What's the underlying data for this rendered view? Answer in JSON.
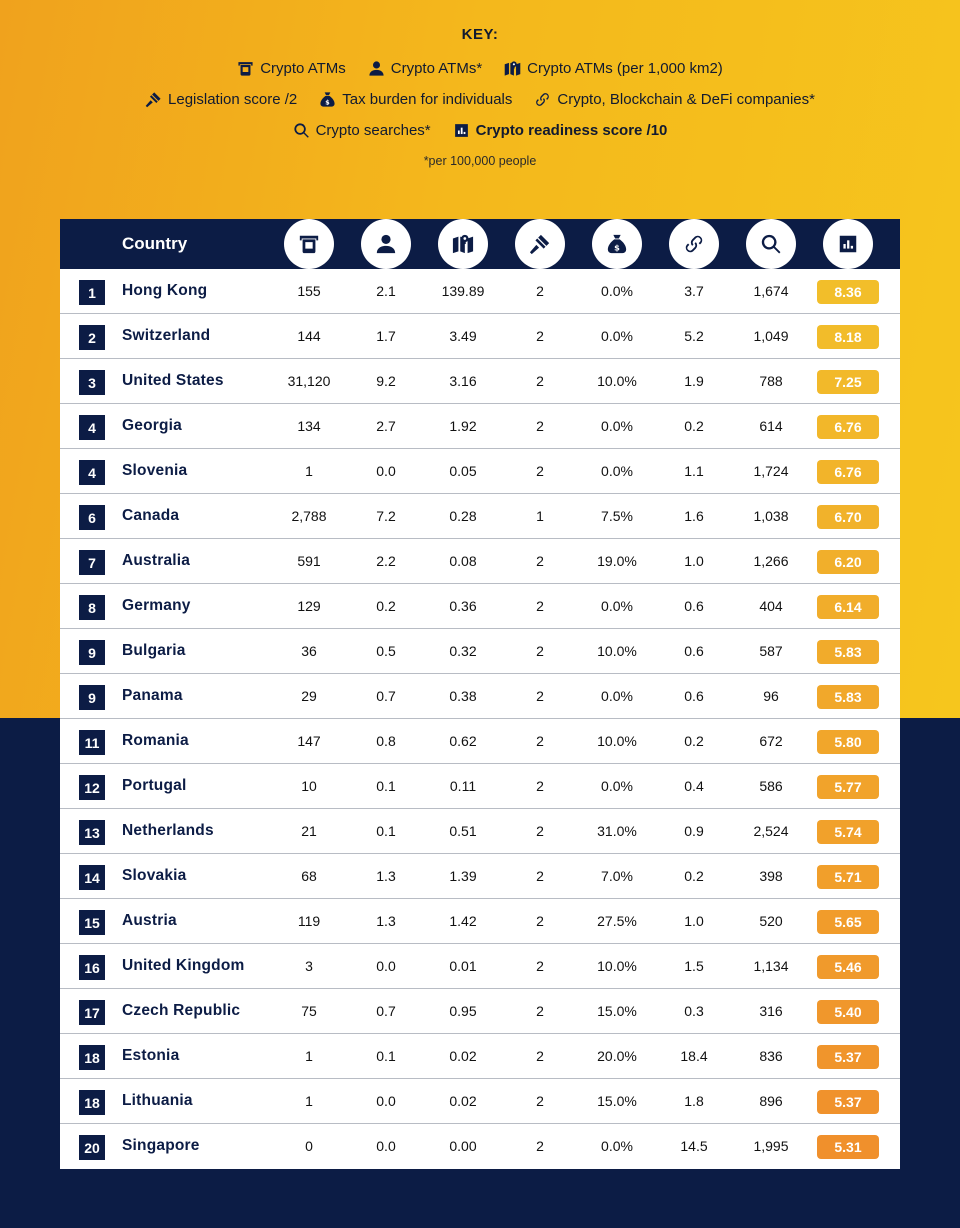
{
  "key": {
    "title": "KEY:",
    "rows": [
      [
        {
          "icon": "atm-icon",
          "label": "Crypto ATMs"
        },
        {
          "icon": "person-icon",
          "label": "Crypto ATMs*"
        },
        {
          "icon": "map-pin-icon",
          "label": "Crypto ATMs (per 1,000 km2)"
        }
      ],
      [
        {
          "icon": "gavel-icon",
          "label": "Legislation score /2"
        },
        {
          "icon": "money-bag-icon",
          "label": "Tax burden for individuals"
        },
        {
          "icon": "chain-link-icon",
          "label": "Crypto, Blockchain & DeFi companies*"
        }
      ],
      [
        {
          "icon": "search-icon",
          "label": "Crypto searches*"
        },
        {
          "icon": "bar-chart-icon",
          "label": "Crypto readiness score /10",
          "bold": true
        }
      ]
    ],
    "note": "*per 100,000 people"
  },
  "table": {
    "country_header": "Country",
    "column_icons": [
      "atm-icon",
      "person-icon",
      "map-pin-icon",
      "gavel-icon",
      "money-bag-icon",
      "chain-link-icon",
      "search-icon",
      "bar-chart-icon"
    ],
    "columns": [
      "Crypto ATMs",
      "Crypto ATMs per 100,000 people",
      "Crypto ATMs per 1,000 km2",
      "Legislation score /2",
      "Tax burden for individuals",
      "Crypto, Blockchain & DeFi companies per 100,000 people",
      "Crypto searches per 100,000 people",
      "Crypto readiness score /10"
    ],
    "rows": [
      {
        "rank": "1",
        "country": "Hong Kong",
        "atms": "155",
        "atms_per_capita": "2.1",
        "atms_per_area": "139.89",
        "legislation": "2",
        "tax": "0.0%",
        "companies": "3.7",
        "searches": "1,674",
        "score": "8.36"
      },
      {
        "rank": "2",
        "country": "Switzerland",
        "atms": "144",
        "atms_per_capita": "1.7",
        "atms_per_area": "3.49",
        "legislation": "2",
        "tax": "0.0%",
        "companies": "5.2",
        "searches": "1,049",
        "score": "8.18"
      },
      {
        "rank": "3",
        "country": "United States",
        "atms": "31,120",
        "atms_per_capita": "9.2",
        "atms_per_area": "3.16",
        "legislation": "2",
        "tax": "10.0%",
        "companies": "1.9",
        "searches": "788",
        "score": "7.25"
      },
      {
        "rank": "4",
        "country": "Georgia",
        "atms": "134",
        "atms_per_capita": "2.7",
        "atms_per_area": "1.92",
        "legislation": "2",
        "tax": "0.0%",
        "companies": "0.2",
        "searches": "614",
        "score": "6.76"
      },
      {
        "rank": "4",
        "country": "Slovenia",
        "atms": "1",
        "atms_per_capita": "0.0",
        "atms_per_area": "0.05",
        "legislation": "2",
        "tax": "0.0%",
        "companies": "1.1",
        "searches": "1,724",
        "score": "6.76"
      },
      {
        "rank": "6",
        "country": "Canada",
        "atms": "2,788",
        "atms_per_capita": "7.2",
        "atms_per_area": "0.28",
        "legislation": "1",
        "tax": "7.5%",
        "companies": "1.6",
        "searches": "1,038",
        "score": "6.70"
      },
      {
        "rank": "7",
        "country": "Australia",
        "atms": "591",
        "atms_per_capita": "2.2",
        "atms_per_area": "0.08",
        "legislation": "2",
        "tax": "19.0%",
        "companies": "1.0",
        "searches": "1,266",
        "score": "6.20"
      },
      {
        "rank": "8",
        "country": "Germany",
        "atms": "129",
        "atms_per_capita": "0.2",
        "atms_per_area": "0.36",
        "legislation": "2",
        "tax": "0.0%",
        "companies": "0.6",
        "searches": "404",
        "score": "6.14"
      },
      {
        "rank": "9",
        "country": "Bulgaria",
        "atms": "36",
        "atms_per_capita": "0.5",
        "atms_per_area": "0.32",
        "legislation": "2",
        "tax": "10.0%",
        "companies": "0.6",
        "searches": "587",
        "score": "5.83"
      },
      {
        "rank": "9",
        "country": "Panama",
        "atms": "29",
        "atms_per_capita": "0.7",
        "atms_per_area": "0.38",
        "legislation": "2",
        "tax": "0.0%",
        "companies": "0.6",
        "searches": "96",
        "score": "5.83"
      },
      {
        "rank": "11",
        "country": "Romania",
        "atms": "147",
        "atms_per_capita": "0.8",
        "atms_per_area": "0.62",
        "legislation": "2",
        "tax": "10.0%",
        "companies": "0.2",
        "searches": "672",
        "score": "5.80"
      },
      {
        "rank": "12",
        "country": "Portugal",
        "atms": "10",
        "atms_per_capita": "0.1",
        "atms_per_area": "0.11",
        "legislation": "2",
        "tax": "0.0%",
        "companies": "0.4",
        "searches": "586",
        "score": "5.77"
      },
      {
        "rank": "13",
        "country": "Netherlands",
        "atms": "21",
        "atms_per_capita": "0.1",
        "atms_per_area": "0.51",
        "legislation": "2",
        "tax": "31.0%",
        "companies": "0.9",
        "searches": "2,524",
        "score": "5.74"
      },
      {
        "rank": "14",
        "country": "Slovakia",
        "atms": "68",
        "atms_per_capita": "1.3",
        "atms_per_area": "1.39",
        "legislation": "2",
        "tax": "7.0%",
        "companies": "0.2",
        "searches": "398",
        "score": "5.71"
      },
      {
        "rank": "15",
        "country": "Austria",
        "atms": "119",
        "atms_per_capita": "1.3",
        "atms_per_area": "1.42",
        "legislation": "2",
        "tax": "27.5%",
        "companies": "1.0",
        "searches": "520",
        "score": "5.65"
      },
      {
        "rank": "16",
        "country": "United Kingdom",
        "atms": "3",
        "atms_per_capita": "0.0",
        "atms_per_area": "0.01",
        "legislation": "2",
        "tax": "10.0%",
        "companies": "1.5",
        "searches": "1,134",
        "score": "5.46"
      },
      {
        "rank": "17",
        "country": "Czech Republic",
        "atms": "75",
        "atms_per_capita": "0.7",
        "atms_per_area": "0.95",
        "legislation": "2",
        "tax": "15.0%",
        "companies": "0.3",
        "searches": "316",
        "score": "5.40"
      },
      {
        "rank": "18",
        "country": "Estonia",
        "atms": "1",
        "atms_per_capita": "0.1",
        "atms_per_area": "0.02",
        "legislation": "2",
        "tax": "20.0%",
        "companies": "18.4",
        "searches": "836",
        "score": "5.37"
      },
      {
        "rank": "18",
        "country": "Lithuania",
        "atms": "1",
        "atms_per_capita": "0.0",
        "atms_per_area": "0.02",
        "legislation": "2",
        "tax": "15.0%",
        "companies": "1.8",
        "searches": "896",
        "score": "5.37"
      },
      {
        "rank": "20",
        "country": "Singapore",
        "atms": "0",
        "atms_per_capita": "0.0",
        "atms_per_area": "0.00",
        "legislation": "2",
        "tax": "0.0%",
        "companies": "14.5",
        "searches": "1,995",
        "score": "5.31"
      }
    ]
  },
  "colors": {
    "navy": "#0c1c45",
    "badge_top": "#f2be2a",
    "badge_bottom": "#f0902c",
    "background_top_left": "#f0a21d",
    "background_top_right": "#f6c61d"
  }
}
